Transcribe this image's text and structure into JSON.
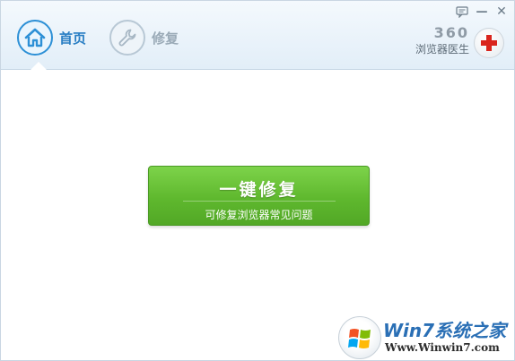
{
  "header": {
    "tabs": [
      {
        "label": "首页",
        "icon": "home-icon",
        "active": true
      },
      {
        "label": "修复",
        "icon": "wrench-icon",
        "active": false
      }
    ],
    "window_controls": {
      "feedback": "feedback-icon",
      "minimize": "—",
      "close": "✕"
    },
    "brand": {
      "number": "360",
      "name": "浏览器医生"
    },
    "colors": {
      "accent": "#2d90d6",
      "header_bg": "#e8f2fa"
    }
  },
  "main": {
    "repair_button": {
      "title": "一键修复",
      "subtitle": "可修复浏览器常见问题",
      "color": "#5fb82e"
    }
  },
  "watermark": {
    "title": "Win7系统之家",
    "url": "Www.Winwin7.com"
  }
}
